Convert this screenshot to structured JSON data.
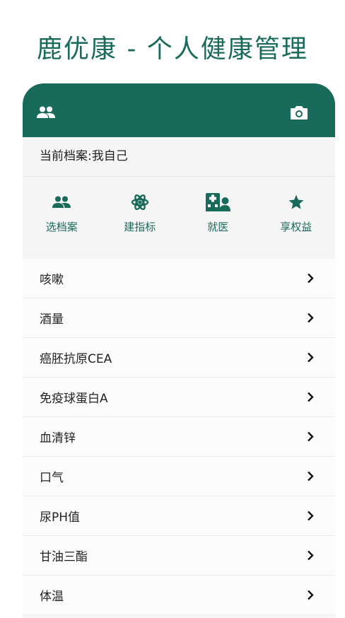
{
  "app": {
    "title": "鹿优康 - 个人健康管理"
  },
  "header": {
    "left_icon": "people-icon",
    "right_icon": "camera-icon"
  },
  "profile": {
    "label": "当前档案:我自己"
  },
  "actions": [
    {
      "label": "选档案",
      "icon": "people-icon"
    },
    {
      "label": "建指标",
      "icon": "atom-icon"
    },
    {
      "label": "就医",
      "icon": "hospital-icon"
    },
    {
      "label": "享权益",
      "icon": "star-icon"
    }
  ],
  "indicators": [
    {
      "label": "咳嗽"
    },
    {
      "label": "酒量"
    },
    {
      "label": "癌胚抗原CEA"
    },
    {
      "label": "免疫球蛋白A"
    },
    {
      "label": "血清锌"
    },
    {
      "label": "口气"
    },
    {
      "label": "尿PH值"
    },
    {
      "label": "甘油三酯"
    },
    {
      "label": "体温"
    }
  ],
  "colors": {
    "brand": "#186a5a",
    "accent_text": "#1a6b5c"
  }
}
